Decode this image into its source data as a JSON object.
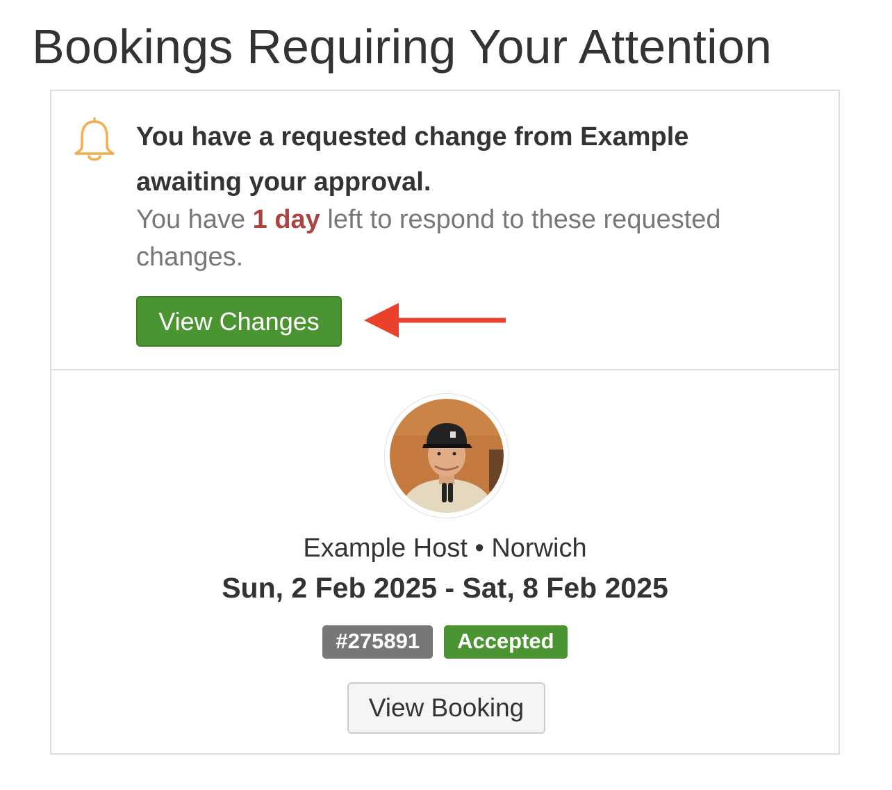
{
  "page": {
    "title": "Bookings Requiring Your Attention"
  },
  "alert": {
    "icon": "bell-icon",
    "icon_color": "#f0ad4e",
    "heading": "You have a requested change from Example awaiting your approval.",
    "body_prefix": "You have ",
    "days_left": "1 day",
    "body_suffix": " left to respond to these requested changes.",
    "days_left_color": "#a94442",
    "view_changes_label": "View Changes",
    "button_color": "#4b9432",
    "annotation": "arrow-left-icon",
    "annotation_color": "#e8412c"
  },
  "booking": {
    "host_name": "Example Host",
    "separator": "•",
    "location": "Norwich",
    "dates": "Sun, 2 Feb 2025 - Sat, 8 Feb 2025",
    "reference": "#275891",
    "status": "Accepted",
    "status_color": "#4b9432",
    "view_booking_label": "View Booking"
  }
}
